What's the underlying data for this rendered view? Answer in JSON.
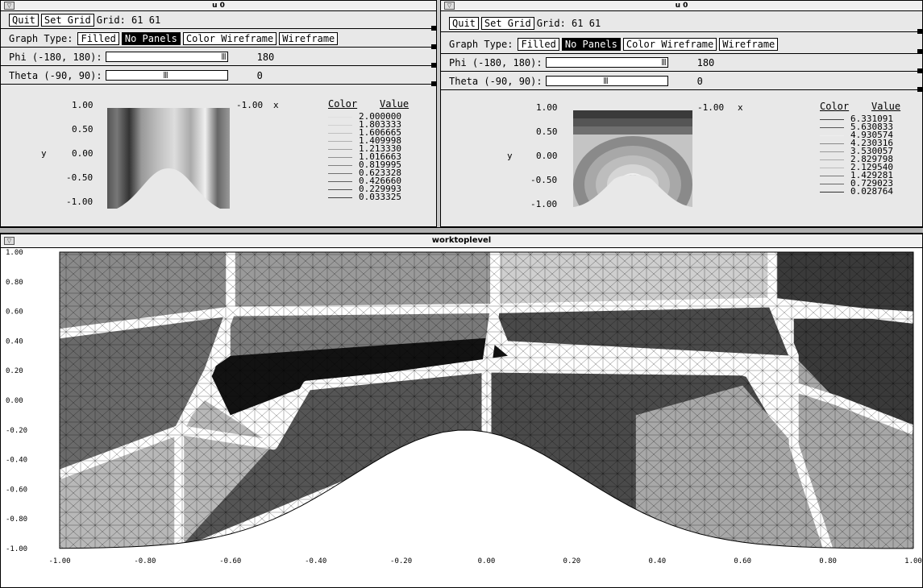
{
  "panels": [
    {
      "title": "u 0",
      "quit": "Quit",
      "set_grid": "Set Grid",
      "grid_label": "Grid:  61 61",
      "graph_type_label": "Graph Type:",
      "graph_types": [
        "Filled",
        "No Panels",
        "Color Wireframe",
        "Wireframe"
      ],
      "selected_graph_type": "No Panels",
      "phi_label": "Phi (-180, 180):",
      "phi_value": "180",
      "phi_fraction": 1.0,
      "theta_label": "Theta (-90, 90):",
      "theta_value": "0",
      "theta_fraction": 0.5,
      "y_ticks": [
        "1.00",
        "0.50",
        "0.00",
        "-0.50",
        "-1.00"
      ],
      "y_label": "y",
      "x_min_label": "-1.00",
      "x_label": "x",
      "legend_color": "Color",
      "legend_value": "Value",
      "legend_values": [
        "2.000000",
        "1.803333",
        "1.606665",
        "1.409998",
        "1.213330",
        "1.016663",
        "0.819995",
        "0.623328",
        "0.426660",
        "0.229993",
        "0.033325"
      ],
      "legend_colors": [
        "#e0e0e0",
        "#d0d0d0",
        "#c0c0c0",
        "#b0b0b0",
        "#a0a0a0",
        "#909090",
        "#808080",
        "#707070",
        "#606060",
        "#505050",
        "#404040"
      ]
    },
    {
      "title": "u 0",
      "quit": "Quit",
      "set_grid": "Set Grid",
      "grid_label": "Grid:  61 61",
      "graph_type_label": "Graph Type:",
      "graph_types": [
        "Filled",
        "No Panels",
        "Color Wireframe",
        "Wireframe"
      ],
      "selected_graph_type": "No Panels",
      "phi_label": "Phi (-180, 180):",
      "phi_value": "180",
      "phi_fraction": 1.0,
      "theta_label": "Theta (-90, 90):",
      "theta_value": "0",
      "theta_fraction": 0.5,
      "y_ticks": [
        "1.00",
        "0.50",
        "0.00",
        "-0.50",
        "-1.00"
      ],
      "y_label": "y",
      "x_min_label": "-1.00",
      "x_label": "x",
      "legend_color": "Color",
      "legend_value": "Value",
      "legend_values": [
        "6.331091",
        "5.630833",
        "4.930574",
        "4.230316",
        "3.530057",
        "2.829798",
        "2.129540",
        "1.429281",
        "0.729023",
        "0.028764"
      ],
      "legend_colors": [
        "#444444",
        "#555555",
        "#eeeeee",
        "#888888",
        "#999999",
        "#aaaaaa",
        "#bbbbbb",
        "#777777",
        "#666666",
        "#333333"
      ]
    }
  ],
  "main_window": {
    "title": "worktoplevel"
  },
  "chart_data": {
    "type": "heatmap",
    "title": "",
    "x_ticks": [
      "-1.00",
      "-0.80",
      "-0.60",
      "-0.40",
      "-0.20",
      "0.00",
      "0.20",
      "0.40",
      "0.60",
      "0.80",
      "1.00"
    ],
    "y_ticks": [
      "1.00",
      "0.80",
      "0.60",
      "0.40",
      "0.20",
      "0.00",
      "-0.20",
      "-0.40",
      "-0.60",
      "-0.80",
      "-1.00"
    ],
    "xlim": [
      -1.0,
      1.0
    ],
    "ylim": [
      -1.0,
      1.0
    ],
    "grid": false,
    "region_colors": [
      "#8a8a8a",
      "#9a9a9a",
      "#cfcfcf",
      "#3a3a3a",
      "#6a6a6a",
      "#7a7a7a",
      "#b8b8b8",
      "#121212",
      "#555555",
      "#4a4a4a",
      "#a8a8a8"
    ],
    "boundary_color": "#ffffff"
  }
}
